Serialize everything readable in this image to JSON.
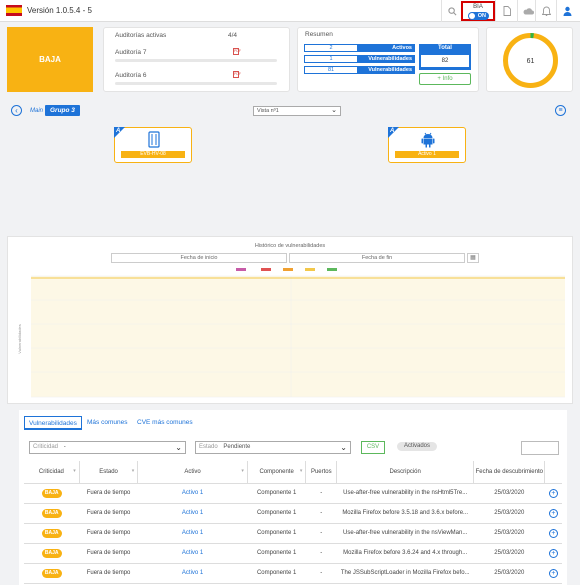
{
  "topbar": {
    "version": "Versión 1.0.5.4 - 5",
    "icons": [
      "search-icon",
      "document-icon",
      "cloud-icon",
      "bell-icon",
      "user-icon"
    ],
    "bia": {
      "label": "BIA",
      "toggle": "ON"
    }
  },
  "summary": {
    "criticality": "BAJA",
    "audits": {
      "title": "Auditorías activas",
      "count": "4/4",
      "items": [
        {
          "label": "Auditoría 7"
        },
        {
          "label": "Auditoría 6"
        }
      ]
    },
    "resumen": {
      "title": "Resumen",
      "rows": [
        {
          "value": "2",
          "label": "Activos"
        },
        {
          "value": "1",
          "label": "Vulnerabilidades"
        },
        {
          "value": "81",
          "label": "Vulnerabilidades"
        }
      ],
      "total_label": "Total",
      "total_value": "82",
      "info_label": "Info"
    },
    "score": {
      "value": "61",
      "fraction": 0.02,
      "color": "#f8b213",
      "accent": "#2fb344"
    }
  },
  "group": {
    "main_label": "Main",
    "group_label": "Grupo 3",
    "view_select": "Vista nº1",
    "assets": [
      {
        "badge": "A",
        "icon": "server-icon",
        "name": "EVB-HV-08"
      },
      {
        "badge": "A",
        "icon": "android-icon",
        "name": "Activo 1"
      }
    ]
  },
  "history": {
    "title": "Histórico de vulnerabilidades",
    "start_date": "Fecha de inicio",
    "end_date": "Fecha de fin",
    "legend_colors": [
      "#c75ca8",
      "#e05252",
      "#f0a030",
      "#f3c84a",
      "#5cb85c"
    ],
    "y_axis_label": "Vulnerabilidades"
  },
  "vulns": {
    "tabs": [
      "Vulnerabilidades",
      "Más comunes",
      "CVE más comunes"
    ],
    "filters": {
      "criticidad_placeholder": "Criticidad",
      "criticidad_value": "-",
      "estado_placeholder": "Estado",
      "estado_value": "Pendiente",
      "csv": "CSV",
      "chip": "Activados"
    },
    "columns": [
      "Criticidad",
      "Estado",
      "Activo",
      "Componente",
      "Puertos",
      "Descripción",
      "Fecha de descubrimiento"
    ],
    "rows": [
      {
        "crit": "BAJA",
        "estado": "Fuera de tiempo",
        "activo": "Activo 1",
        "componente": "Componente 1",
        "puertos": "-",
        "desc": "Use-after-free vulnerability in the nsHtml5Tre...",
        "fecha": "25/03/2020"
      },
      {
        "crit": "BAJA",
        "estado": "Fuera de tiempo",
        "activo": "Activo 1",
        "componente": "Componente 1",
        "puertos": "-",
        "desc": "Mozilla Firefox before 3.5.18 and 3.6.x before...",
        "fecha": "25/03/2020"
      },
      {
        "crit": "BAJA",
        "estado": "Fuera de tiempo",
        "activo": "Activo 1",
        "componente": "Componente 1",
        "puertos": "-",
        "desc": "Use-after-free vulnerability in the nsViewMan...",
        "fecha": "25/03/2020"
      },
      {
        "crit": "BAJA",
        "estado": "Fuera de tiempo",
        "activo": "Activo 1",
        "componente": "Componente 1",
        "puertos": "-",
        "desc": "Mozilla Firefox before 3.6.24 and 4.x through...",
        "fecha": "25/03/2020"
      },
      {
        "crit": "BAJA",
        "estado": "Fuera de tiempo",
        "activo": "Activo 1",
        "componente": "Componente 1",
        "puertos": "-",
        "desc": "The JSSubScriptLoader in Mozilla Firefox befo...",
        "fecha": "25/03/2020"
      }
    ]
  }
}
